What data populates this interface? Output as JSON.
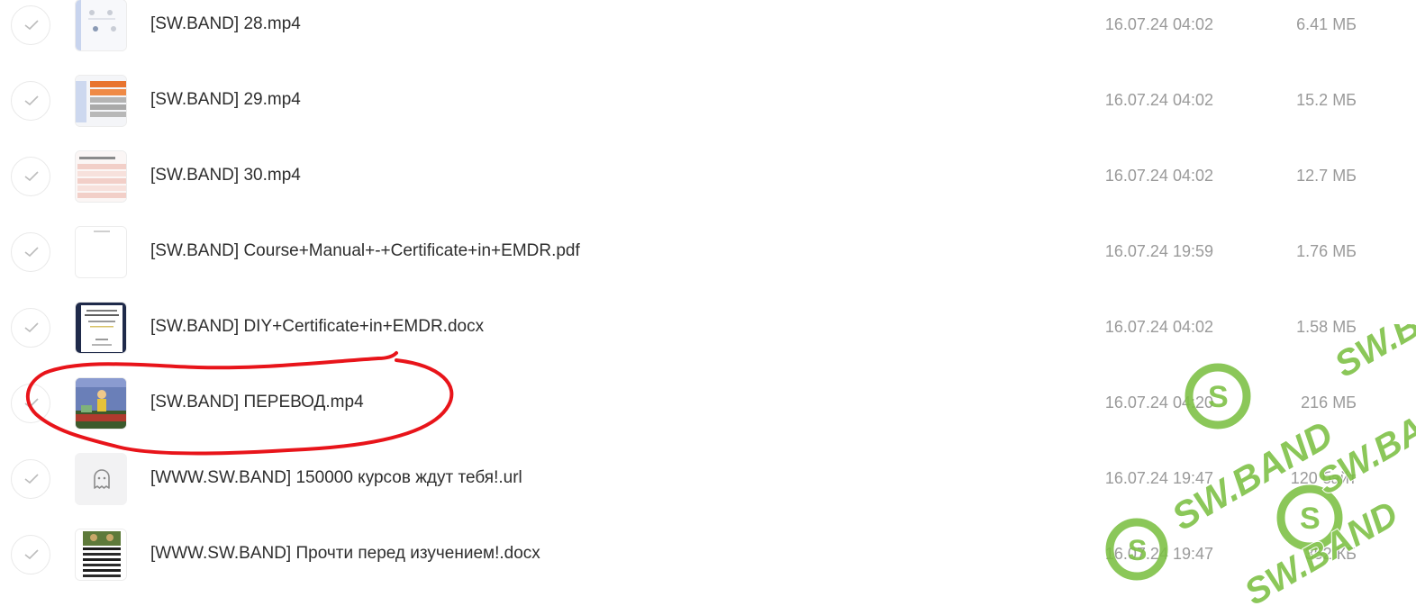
{
  "files": [
    {
      "name": "[SW.BAND] 28.mp4",
      "date": "16.07.24 04:02",
      "size": "6.41 МБ",
      "thumb": "video-slide-icons"
    },
    {
      "name": "[SW.BAND] 29.mp4",
      "date": "16.07.24 04:02",
      "size": "15.2 МБ",
      "thumb": "video-slide-orange"
    },
    {
      "name": "[SW.BAND] 30.mp4",
      "date": "16.07.24 04:02",
      "size": "12.7 МБ",
      "thumb": "video-slide-table"
    },
    {
      "name": "[SW.BAND] Course+Manual+-+Certificate+in+EMDR.pdf",
      "date": "16.07.24 19:59",
      "size": "1.76 МБ",
      "thumb": "pdf-page"
    },
    {
      "name": "[SW.BAND] DIY+Certificate+in+EMDR.docx",
      "date": "16.07.24 04:02",
      "size": "1.58 МБ",
      "thumb": "certificate-doc"
    },
    {
      "name": "[SW.BAND] ПЕРЕВОД.mp4",
      "date": "16.07.24 04:20",
      "size": "216 МБ",
      "thumb": "cartoon-video"
    },
    {
      "name": "[WWW.SW.BAND] 150000 курсов ждут тебя!.url",
      "date": "16.07.24 19:47",
      "size": "120 байт",
      "thumb": "ghost-icon"
    },
    {
      "name": "[WWW.SW.BAND] Прочти перед изучением!.docx",
      "date": "16.07.24 19:47",
      "size": "352 КБ",
      "thumb": "doc-preview"
    }
  ],
  "watermark": {
    "text": "SW.BAND",
    "color": "#7cc043"
  },
  "annotation": {
    "color": "#e8141a",
    "highlighted_file": "[SW.BAND] ПЕРЕВОД.mp4"
  }
}
